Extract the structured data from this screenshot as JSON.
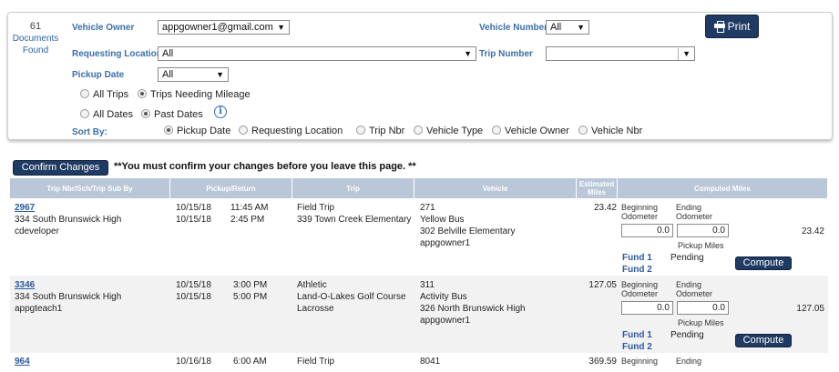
{
  "summary": {
    "count": "61",
    "label_line1": "Documents",
    "label_line2": "Found"
  },
  "filters": {
    "vehicle_owner_label": "Vehicle Owner",
    "vehicle_owner_value": "appgowner1@gmail.com",
    "vehicle_number_label": "Vehicle Number",
    "vehicle_number_value": "All",
    "requesting_location_label": "Requesting Location",
    "requesting_location_value": "All",
    "trip_number_label": "Trip Number",
    "trip_number_value": "",
    "pickup_date_label": "Pickup Date",
    "pickup_date_value": "All",
    "print_label": "Print",
    "trip_options": [
      "All Trips",
      "Trips Needing Mileage"
    ],
    "date_options": [
      "All Dates",
      "Past Dates"
    ],
    "sort_by_label": "Sort By:",
    "sort_options": [
      "Pickup Date",
      "Requesting Location",
      "Trip Nbr",
      "Vehicle Type",
      "Vehicle Owner",
      "Vehicle Nbr"
    ]
  },
  "confirm": {
    "button_label": "Confirm Changes",
    "message": "**You must confirm your changes before you leave this page. **"
  },
  "table": {
    "headers": [
      "Trip Nbr/Sch/Trip Sub By",
      "Pickup/Return",
      "Trip",
      "Vehicle",
      "Estimated Miles",
      "Computed Miles"
    ],
    "computed_labels": {
      "beginning": "Beginning",
      "ending": "Ending",
      "odometer": "Odometer",
      "pickup_miles": "Pickup Miles",
      "fund1": "Fund 1",
      "fund2": "Fund 2",
      "pending": "Pending",
      "compute": "Compute"
    },
    "rows": [
      {
        "trip_nbr": "2967",
        "school": "334 South Brunswick High",
        "sub_by": "cdeveloper",
        "pickup_date": "10/15/18",
        "pickup_time": "11:45 AM",
        "return_date": "10/15/18",
        "return_time": "2:45 PM",
        "trip_type": "Field Trip",
        "trip_dest": "339 Town Creek Elementary",
        "trip_extra": "",
        "vehicle_nbr": "271",
        "vehicle_type": "Yellow Bus",
        "vehicle_loc": "302 Belville Elementary",
        "vehicle_owner": "appgowner1",
        "est_miles": "23.42",
        "begin_odo": "0.0",
        "end_odo": "0.0",
        "computed": "23.42"
      },
      {
        "trip_nbr": "3346",
        "school": "334 South Brunswick High",
        "sub_by": "appgteach1",
        "pickup_date": "10/15/18",
        "pickup_time": "3:00 PM",
        "return_date": "10/15/18",
        "return_time": "5:00 PM",
        "trip_type": "Athletic",
        "trip_dest": "Land-O-Lakes Golf Course",
        "trip_extra": "Lacrosse",
        "vehicle_nbr": "311",
        "vehicle_type": "Activity Bus",
        "vehicle_loc": "326 North Brunswick High",
        "vehicle_owner": "appgowner1",
        "est_miles": "127.05",
        "begin_odo": "0.0",
        "end_odo": "0.0",
        "computed": "127.05"
      },
      {
        "trip_nbr": "964",
        "pickup_date": "10/16/18",
        "pickup_time": "6:00 AM",
        "trip_type": "Field Trip",
        "vehicle_nbr": "8041",
        "est_miles": "369.59"
      }
    ]
  }
}
